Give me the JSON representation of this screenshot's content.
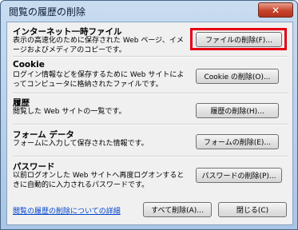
{
  "window": {
    "title": "閲覧の履歴の削除",
    "close_label": "✕"
  },
  "sections": [
    {
      "title": "インターネット一時ファイル",
      "desc": "表示の高速化のために保存された Web ページ、イメージおよびメディアのコピーです。",
      "button": "ファイルの削除(F)..."
    },
    {
      "title": "Cookie",
      "desc": "ログイン情報などを保存するために Web サイトによってコンピュータに格納されたファイルです。",
      "button": "Cookie の削除(O)..."
    },
    {
      "title": "履歴",
      "desc": "閲覧した Web サイトの一覧です。",
      "button": "履歴の削除(H)..."
    },
    {
      "title": "フォーム データ",
      "desc": "フォームに入力して保存された情報です。",
      "button": "フォームの削除(E)..."
    },
    {
      "title": "パスワード",
      "desc": "以前ログオンした Web サイトへ再度ログオンするときに自動的に入力されるパスワードです。",
      "button": "パスワードの削除(P)..."
    }
  ],
  "footer": {
    "link": "閲覧の履歴の削除についての詳細",
    "delete_all": "すべて削除(A)...",
    "close": "閉じる(C)"
  },
  "highlight_color": "#e60012"
}
